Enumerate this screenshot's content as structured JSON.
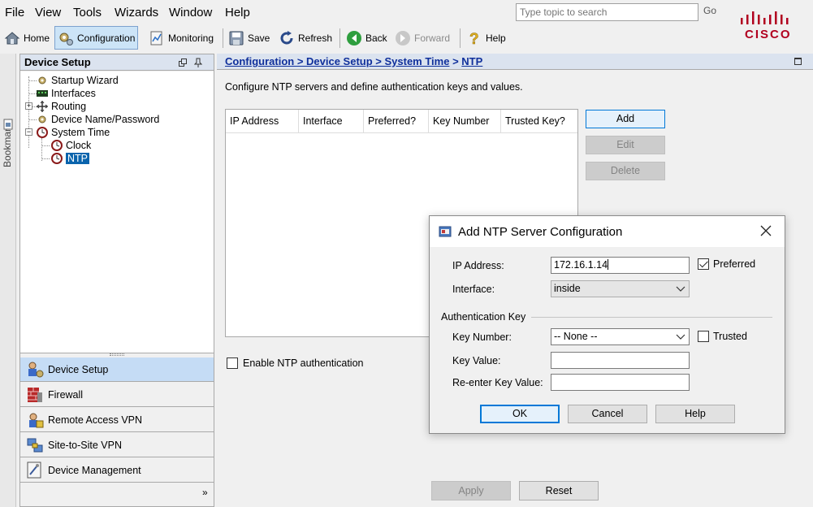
{
  "menu": {
    "items": [
      "File",
      "View",
      "Tools",
      "Wizards",
      "Window",
      "Help"
    ]
  },
  "search": {
    "placeholder": "Type topic to search",
    "go_label": "Go"
  },
  "brand": {
    "logo_text": "CISCO",
    "color": "#b1001f"
  },
  "toolbar": {
    "home": "Home",
    "configuration": "Configuration",
    "monitoring": "Monitoring",
    "save": "Save",
    "refresh": "Refresh",
    "back": "Back",
    "forward": "Forward",
    "help": "Help"
  },
  "bookmarks": {
    "label": "Bookmarks"
  },
  "left_panel": {
    "title": "Device Setup",
    "tree": {
      "startup_wizard": "Startup Wizard",
      "interfaces": "Interfaces",
      "routing": "Routing",
      "device_name_password": "Device Name/Password",
      "system_time": "System Time",
      "clock": "Clock",
      "ntp": "NTP"
    },
    "nav": {
      "device_setup": "Device Setup",
      "firewall": "Firewall",
      "remote_access_vpn": "Remote Access VPN",
      "site_to_site_vpn": "Site-to-Site VPN",
      "device_management": "Device Management"
    }
  },
  "breadcrumb": {
    "path": "Configuration > Device Setup > System Time",
    "separator": ">",
    "current": "NTP"
  },
  "main": {
    "description": "Configure NTP servers and define authentication keys and values.",
    "table": {
      "columns": [
        "IP Address",
        "Interface",
        "Preferred?",
        "Key Number",
        "Trusted Key?"
      ],
      "rows": []
    },
    "buttons": {
      "add": "Add",
      "edit": "Edit",
      "delete": "Delete"
    },
    "enable_auth_label": "Enable NTP authentication",
    "enable_auth_checked": false,
    "apply": "Apply",
    "reset": "Reset"
  },
  "dialog": {
    "title": "Add NTP Server Configuration",
    "ip_address_label": "IP Address:",
    "ip_address_value": "172.16.1.14",
    "preferred_label": "Preferred",
    "preferred_checked": true,
    "interface_label": "Interface:",
    "interface_value": "inside",
    "auth_group_label": "Authentication Key",
    "key_number_label": "Key Number:",
    "key_number_value": "-- None --",
    "trusted_label": "Trusted",
    "trusted_checked": false,
    "key_value_label": "Key Value:",
    "key_value": "",
    "reenter_label": "Re-enter Key Value:",
    "reenter_value": "",
    "ok": "OK",
    "cancel": "Cancel",
    "help": "Help"
  }
}
